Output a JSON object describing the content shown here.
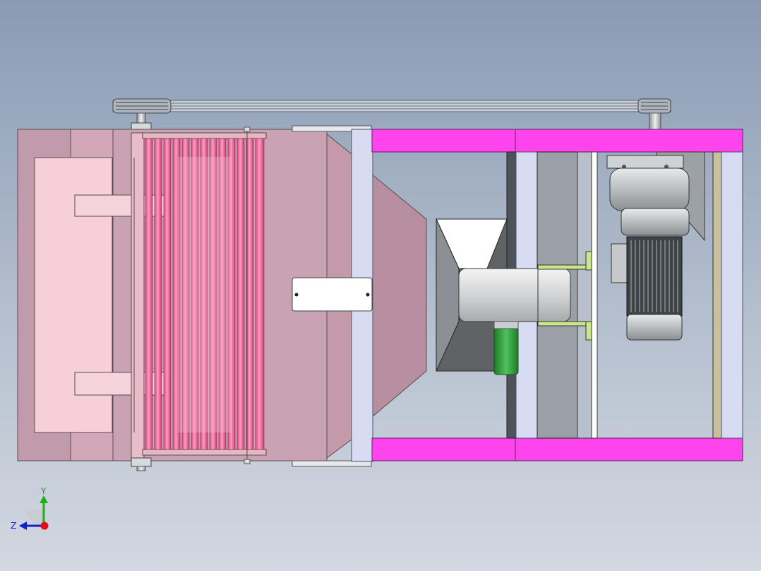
{
  "viewport": {
    "background_top": "#8b9bb4",
    "background_bottom": "#d3d8e1"
  },
  "model": {
    "components": [
      "drive-belt",
      "large-pulley",
      "small-pulley",
      "roller-screen-housing",
      "pink-rollers",
      "feed-hopper",
      "frame-rail-top",
      "frame-rail-bottom",
      "cross-beam",
      "fan-impeller",
      "blower-hood",
      "green-motor",
      "gear-motor",
      "motor-mount-bracket",
      "label-plate"
    ],
    "colors": {
      "frame": "#ff44ee",
      "housing": "#c9a3b3",
      "rollers": "#f77aa6",
      "beam": "#d8dcf2",
      "metal": "#b8bcbe",
      "green_motor": "#3fae4d",
      "belt": "#a9b3bd"
    }
  },
  "triad": {
    "y_label": "Y",
    "z_label": "Z",
    "x_color": "#e01010",
    "y_color": "#19b019",
    "z_color": "#1020d0"
  }
}
